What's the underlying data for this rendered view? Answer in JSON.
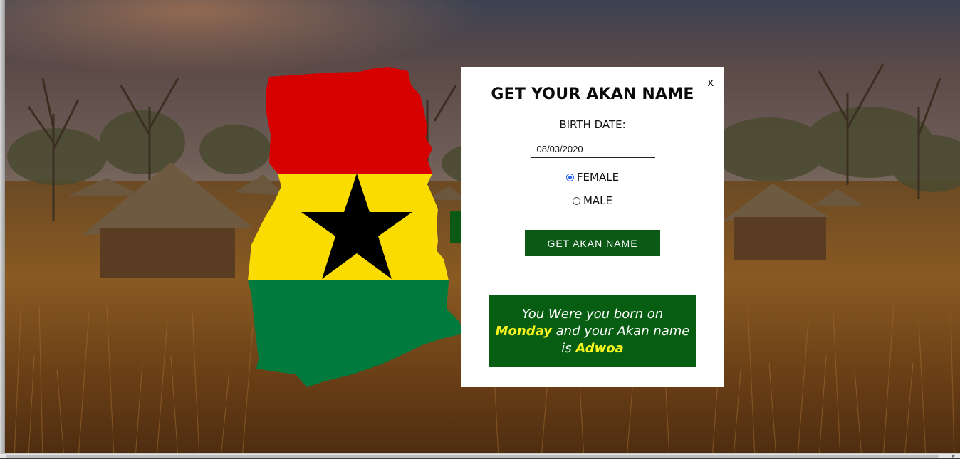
{
  "modal": {
    "close_label": "x",
    "title": "GET YOUR AKAN NAME",
    "birth_label": "BIRTH DATE:",
    "date_value": "08/03/2020",
    "gender_options": [
      {
        "label": "FEMALE",
        "checked": true
      },
      {
        "label": "MALE",
        "checked": false
      }
    ],
    "submit_label": "GET AKAN NAME",
    "result": {
      "intro": "You Were you born on",
      "day": "Monday",
      "middle": "and your Akan name",
      "is_text": "is",
      "name": "Adwoa"
    }
  },
  "colors": {
    "flag_red": "#d70000",
    "flag_yellow": "#fbdc00",
    "flag_green": "#007a3d",
    "star": "#000000",
    "button_green": "#0a5a16",
    "highlight": "#f7f51d"
  },
  "icons": {
    "background": "african-village-photo",
    "map": "ghana-flag-map"
  }
}
